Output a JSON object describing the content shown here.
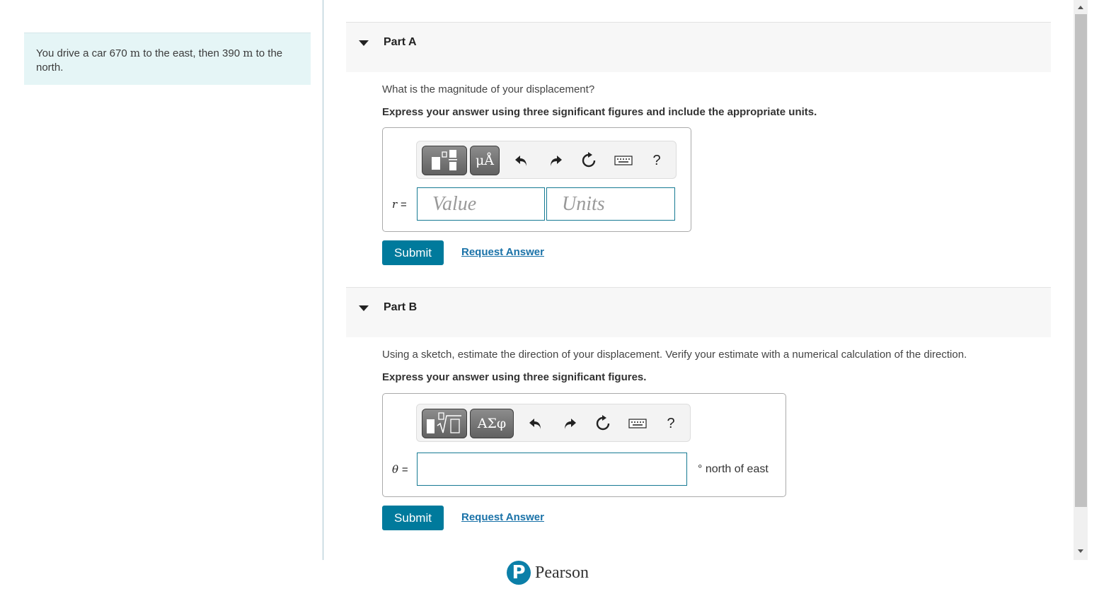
{
  "intro": {
    "text_before_1": "You drive a car 670 ",
    "unit_1": "m",
    "text_middle": " to the east, then 390 ",
    "unit_2": "m",
    "text_after": " to the north."
  },
  "part_a": {
    "title": "Part A",
    "question": "What is the magnitude of your displacement?",
    "instruction": "Express your answer using three significant figures and include the appropriate units.",
    "toolbar": {
      "templates_icon": "fraction-template-icon",
      "units_label": "μÅ",
      "undo_icon": "undo-icon",
      "redo_icon": "redo-icon",
      "reset_icon": "reset-icon",
      "keyboard_icon": "keyboard-icon",
      "help_label": "?"
    },
    "variable": "r",
    "equals": "=",
    "value_placeholder": "Value",
    "units_placeholder": "Units",
    "value": "",
    "units": "",
    "submit_label": "Submit",
    "request_answer_label": "Request Answer"
  },
  "part_b": {
    "title": "Part B",
    "question": "Using a sketch, estimate the direction of your displacement. Verify your estimate with a numerical calculation of the direction.",
    "instruction": "Express your answer using three significant figures.",
    "toolbar": {
      "templates_icon": "radical-template-icon",
      "symbols_label": "ΑΣφ",
      "undo_icon": "undo-icon",
      "redo_icon": "redo-icon",
      "reset_icon": "reset-icon",
      "keyboard_icon": "keyboard-icon",
      "help_label": "?"
    },
    "variable": "θ",
    "equals": "=",
    "value": "",
    "unit_suffix": "° north of east",
    "submit_label": "Submit",
    "request_answer_label": "Request Answer"
  },
  "footer": {
    "brand": "Pearson",
    "logo_letter": "P"
  },
  "colors": {
    "accent": "#007a9c",
    "link": "#1a72a8",
    "intro_bg": "#e5f5f6"
  }
}
